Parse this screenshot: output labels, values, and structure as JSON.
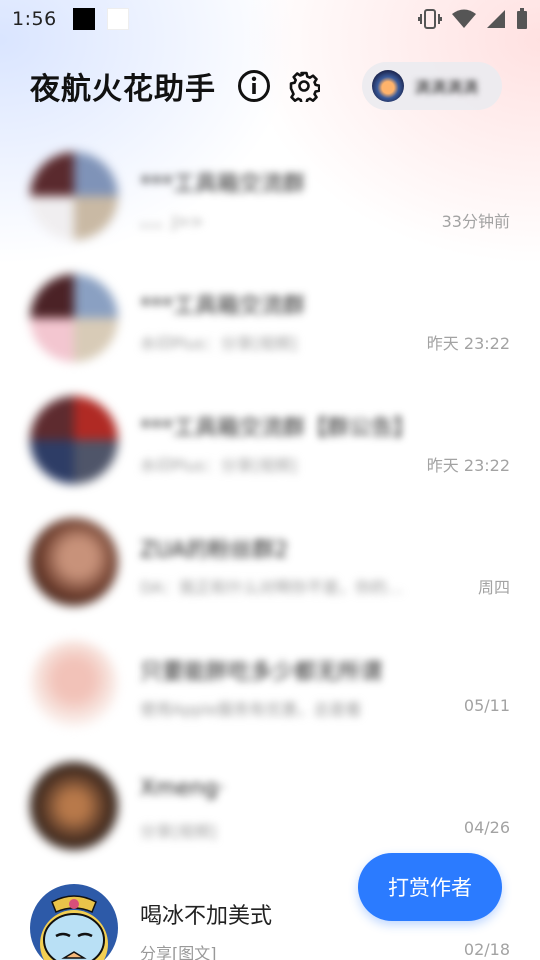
{
  "status_bar": {
    "time": "1:56",
    "icons": [
      "vibrate-icon",
      "wifi-icon",
      "signal-icon",
      "battery-icon"
    ]
  },
  "header": {
    "title": "夜航火花助手",
    "info_icon": "info-icon",
    "settings_icon": "gear-icon",
    "user_name": "满满满满"
  },
  "chats": [
    {
      "name": "***工具箱交流群",
      "preview": "。。。J>>",
      "time": "33分钟前",
      "blurred": true
    },
    {
      "name": "***工具箱交流群",
      "preview": "水印Plus：分享[视频]",
      "time": "昨天 23:22",
      "blurred": true
    },
    {
      "name": "***工具箱交流群【群公告】",
      "preview": "水印Plus：分享[视频]",
      "time": "昨天 23:22",
      "blurred": true
    },
    {
      "name": "ZUA的粉丝群2",
      "preview": "DA：我正和什么对啊你不是，你的…",
      "time": "周四",
      "blurred": true
    },
    {
      "name": "只要能胖吃多少都无所谓",
      "preview": "使用Apple服务有优惠，总是看",
      "time": "05/11",
      "blurred": true
    },
    {
      "name": "Xmeng·",
      "preview": "分享[视频]",
      "time": "04/26",
      "blurred": true
    },
    {
      "name": "喝冰不加美式",
      "preview": "分享[图文]",
      "time": "02/18",
      "blurred": false
    }
  ],
  "fab": {
    "label": "打赏作者"
  },
  "colors": {
    "accent": "#2b7bff",
    "time_text": "#a3a3a3"
  }
}
